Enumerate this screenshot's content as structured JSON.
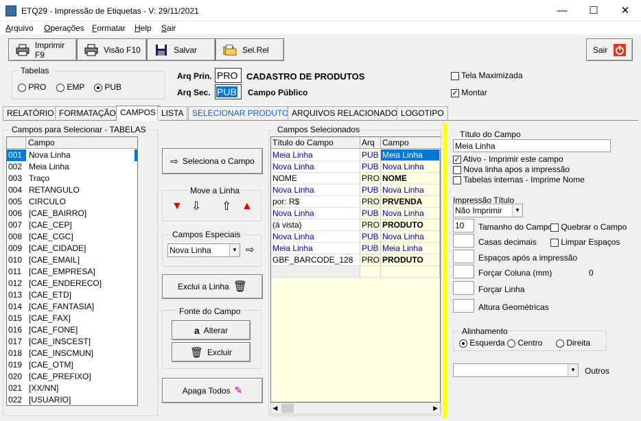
{
  "window": {
    "title": "ETQ29 - Impressão de Etiquetas - V: 29/11/2021",
    "min": "—",
    "max": "☐",
    "close": "✕"
  },
  "menu": [
    "Arquivo",
    "Operações",
    "Formatar",
    "Help",
    "Sair"
  ],
  "toolbar": {
    "print": "Imprimir F9",
    "preview": "Visão F10",
    "save": "Salvar",
    "selrel": "Sel.Rel",
    "exit": "Sair"
  },
  "tabelas": {
    "label": "Tabelas",
    "opts": [
      "PRO",
      "EMP",
      "PUB"
    ],
    "selected": "PUB"
  },
  "arq": {
    "prin_label": "Arq Prin.",
    "prin_value": "PRO",
    "prin_desc": "CADASTRO DE PRODUTOS",
    "sec_label": "Arq Sec.",
    "sec_value": "PUB",
    "sec_desc": "Campo Público"
  },
  "options": {
    "tela_max": "Tela Maximizada",
    "tela_max_checked": false,
    "montar": "Montar",
    "montar_checked": true
  },
  "tabs": [
    "RELATÓRIO",
    "FORMATAÇÃO",
    "CAMPOS",
    "LISTA",
    "SELECIONAR PRODUTOS",
    "ARQUIVOS RELACIONADOS",
    "LOGOTIPO"
  ],
  "active_tab": "CAMPOS",
  "left_panel": {
    "title": "Campos para Selecionar  - TABELAS",
    "col": "Campo",
    "rows": [
      [
        "001",
        "Nova Linha"
      ],
      [
        "002",
        "Meia Linha"
      ],
      [
        "003",
        "Traço"
      ],
      [
        "004",
        "RETANGULO"
      ],
      [
        "005",
        "CIRCULO"
      ],
      [
        "006",
        "[CAE_BAIRRO]"
      ],
      [
        "007",
        "[CAE_CEP]"
      ],
      [
        "008",
        "[CAE_CGC]"
      ],
      [
        "009",
        "[CAE_CIDADE]"
      ],
      [
        "010",
        "[CAE_EMAIL]"
      ],
      [
        "011",
        "[CAE_EMPRESA]"
      ],
      [
        "012",
        "[CAE_ENDERECO]"
      ],
      [
        "013",
        "[CAE_ETD]"
      ],
      [
        "014",
        "[CAE_FANTASIA]"
      ],
      [
        "015",
        "[CAE_FAX]"
      ],
      [
        "016",
        "[CAE_FONE]"
      ],
      [
        "017",
        "[CAE_INSCEST]"
      ],
      [
        "018",
        "[CAE_INSCMUN]"
      ],
      [
        "019",
        "[CAE_OTM]"
      ],
      [
        "020",
        "[CAE_PREFIXO]"
      ],
      [
        "021",
        "[XX/NN]"
      ],
      [
        "022",
        "[USUARIO]"
      ]
    ]
  },
  "middle": {
    "seleciona": "Seleciona o Campo",
    "move_title": "Move a Linha",
    "especiais_title": "Campos Especiais",
    "especiais_value": "Nova Linha",
    "exclui": "Exclui a Linha",
    "fonte_title": "Fonte do Campo",
    "alterar": "Alterar",
    "excluir": "Excluir",
    "apaga": "Apaga Todos"
  },
  "selected_panel": {
    "title": "Campos Selecionados",
    "cols": [
      "Título do Campo",
      "Arq",
      "Campo"
    ],
    "rows": [
      [
        "Meia Linha",
        "PUB",
        "Meia Linha",
        "sel"
      ],
      [
        "Nova Linha",
        "PUB",
        "Nova Linha",
        "blue"
      ],
      [
        "NOME",
        "PRO",
        "NOME",
        "bold"
      ],
      [
        "Nova Linha",
        "PUB",
        "Nova Linha",
        "blue"
      ],
      [
        "  por: R$",
        "PRO",
        "PRVENDA",
        "bold"
      ],
      [
        "Nova Linha",
        "PUB",
        "Nova Linha",
        "blue"
      ],
      [
        "(à vista)",
        "PRO",
        "PRODUTO",
        "bold"
      ],
      [
        "Nova Linha",
        "PUB",
        "Nova Linha",
        "blue"
      ],
      [
        "Meia Linha",
        "PUB",
        "Meia Linha",
        "blue"
      ],
      [
        "GBF_BARCODE_128",
        "PRO",
        "PRODUTO",
        "bold"
      ],
      [
        "",
        "",
        "",
        "empty"
      ]
    ]
  },
  "right": {
    "titulo_label": "Título do Campo",
    "titulo_value": "Meia Linha",
    "ativo": "Ativo - Imprimir este campo",
    "ativo_checked": true,
    "nova_linha": "Nova linha apos a impressão",
    "tabelas_internas": "Tabelas internas - Imprime Nome",
    "impressao_label": "Impressão Título",
    "impressao_value": "Não Imprimir",
    "tamanho_value": "10",
    "tamanho_label": "Tamanho do Campo",
    "quebrar": "Quebrar o Campo",
    "casas": "Casas decimais",
    "limpar": "Limpar Espaços",
    "espacos": "Espaços após a impressão",
    "forcar_coluna": "Forçar Coluna (mm)",
    "forcar_coluna_value": "0",
    "forcar_linha": "Forçar Linha",
    "altura": "Altura Geométricas",
    "alinhamento": "Alinhamento",
    "align_opts": [
      "Esquerda",
      "Centro",
      "Direita"
    ],
    "align_selected": "Esquerda",
    "outros": "Outros"
  },
  "colors": {
    "accent_yellow": "#ffff00",
    "grid_yellow": "#ffffe1",
    "select_blue": "#0078d7",
    "link_blue": "#0000cc"
  }
}
